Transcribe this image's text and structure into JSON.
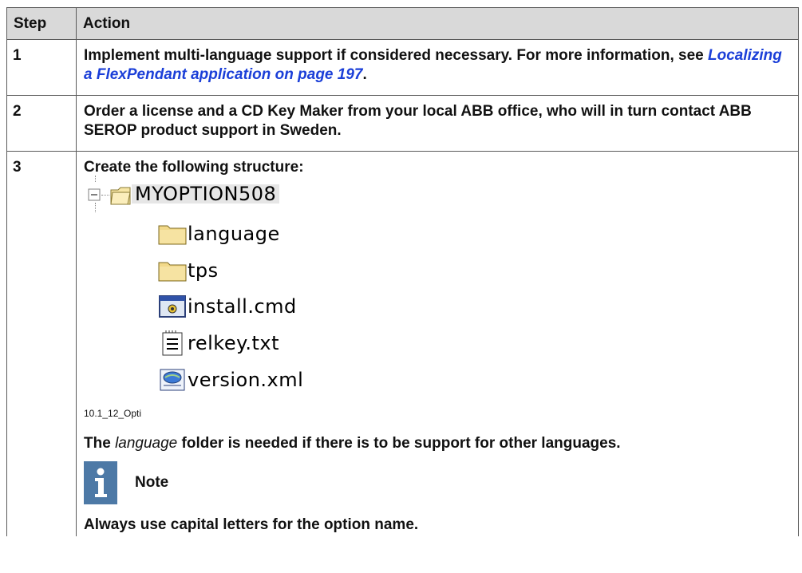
{
  "table": {
    "headers": {
      "step": "Step",
      "action": "Action"
    },
    "rows": [
      {
        "step": "1",
        "text_before": "Implement multi-language support if considered necessary. For more information, see ",
        "link": "Localizing a FlexPendant application on page 197",
        "text_after": "."
      },
      {
        "step": "2",
        "text": "Order a license and a CD Key Maker from your local ABB office, who will in turn contact ABB SEROP product support in Sweden."
      },
      {
        "step": "3",
        "intro": "Create the following structure:",
        "tree": {
          "root": "MYOPTION508",
          "items": [
            {
              "name": "language",
              "icon": "folder-icon"
            },
            {
              "name": "tps",
              "icon": "folder-icon"
            },
            {
              "name": "install.cmd",
              "icon": "cmd-file-icon"
            },
            {
              "name": "relkey.txt",
              "icon": "text-file-icon"
            },
            {
              "name": "version.xml",
              "icon": "xml-file-icon"
            }
          ]
        },
        "figure_caption": "10.1_12_Opti",
        "para_pre": "The ",
        "para_em": "language",
        "para_post": " folder is needed if there is to be support for other languages.",
        "note_title": "Note",
        "note_text": "Always use capital letters for the option name."
      }
    ]
  },
  "colors": {
    "header_bg": "#d9d9d9",
    "link": "#1b3fd8",
    "note_icon": "#4d79a6",
    "folder": "#f2d98a"
  }
}
